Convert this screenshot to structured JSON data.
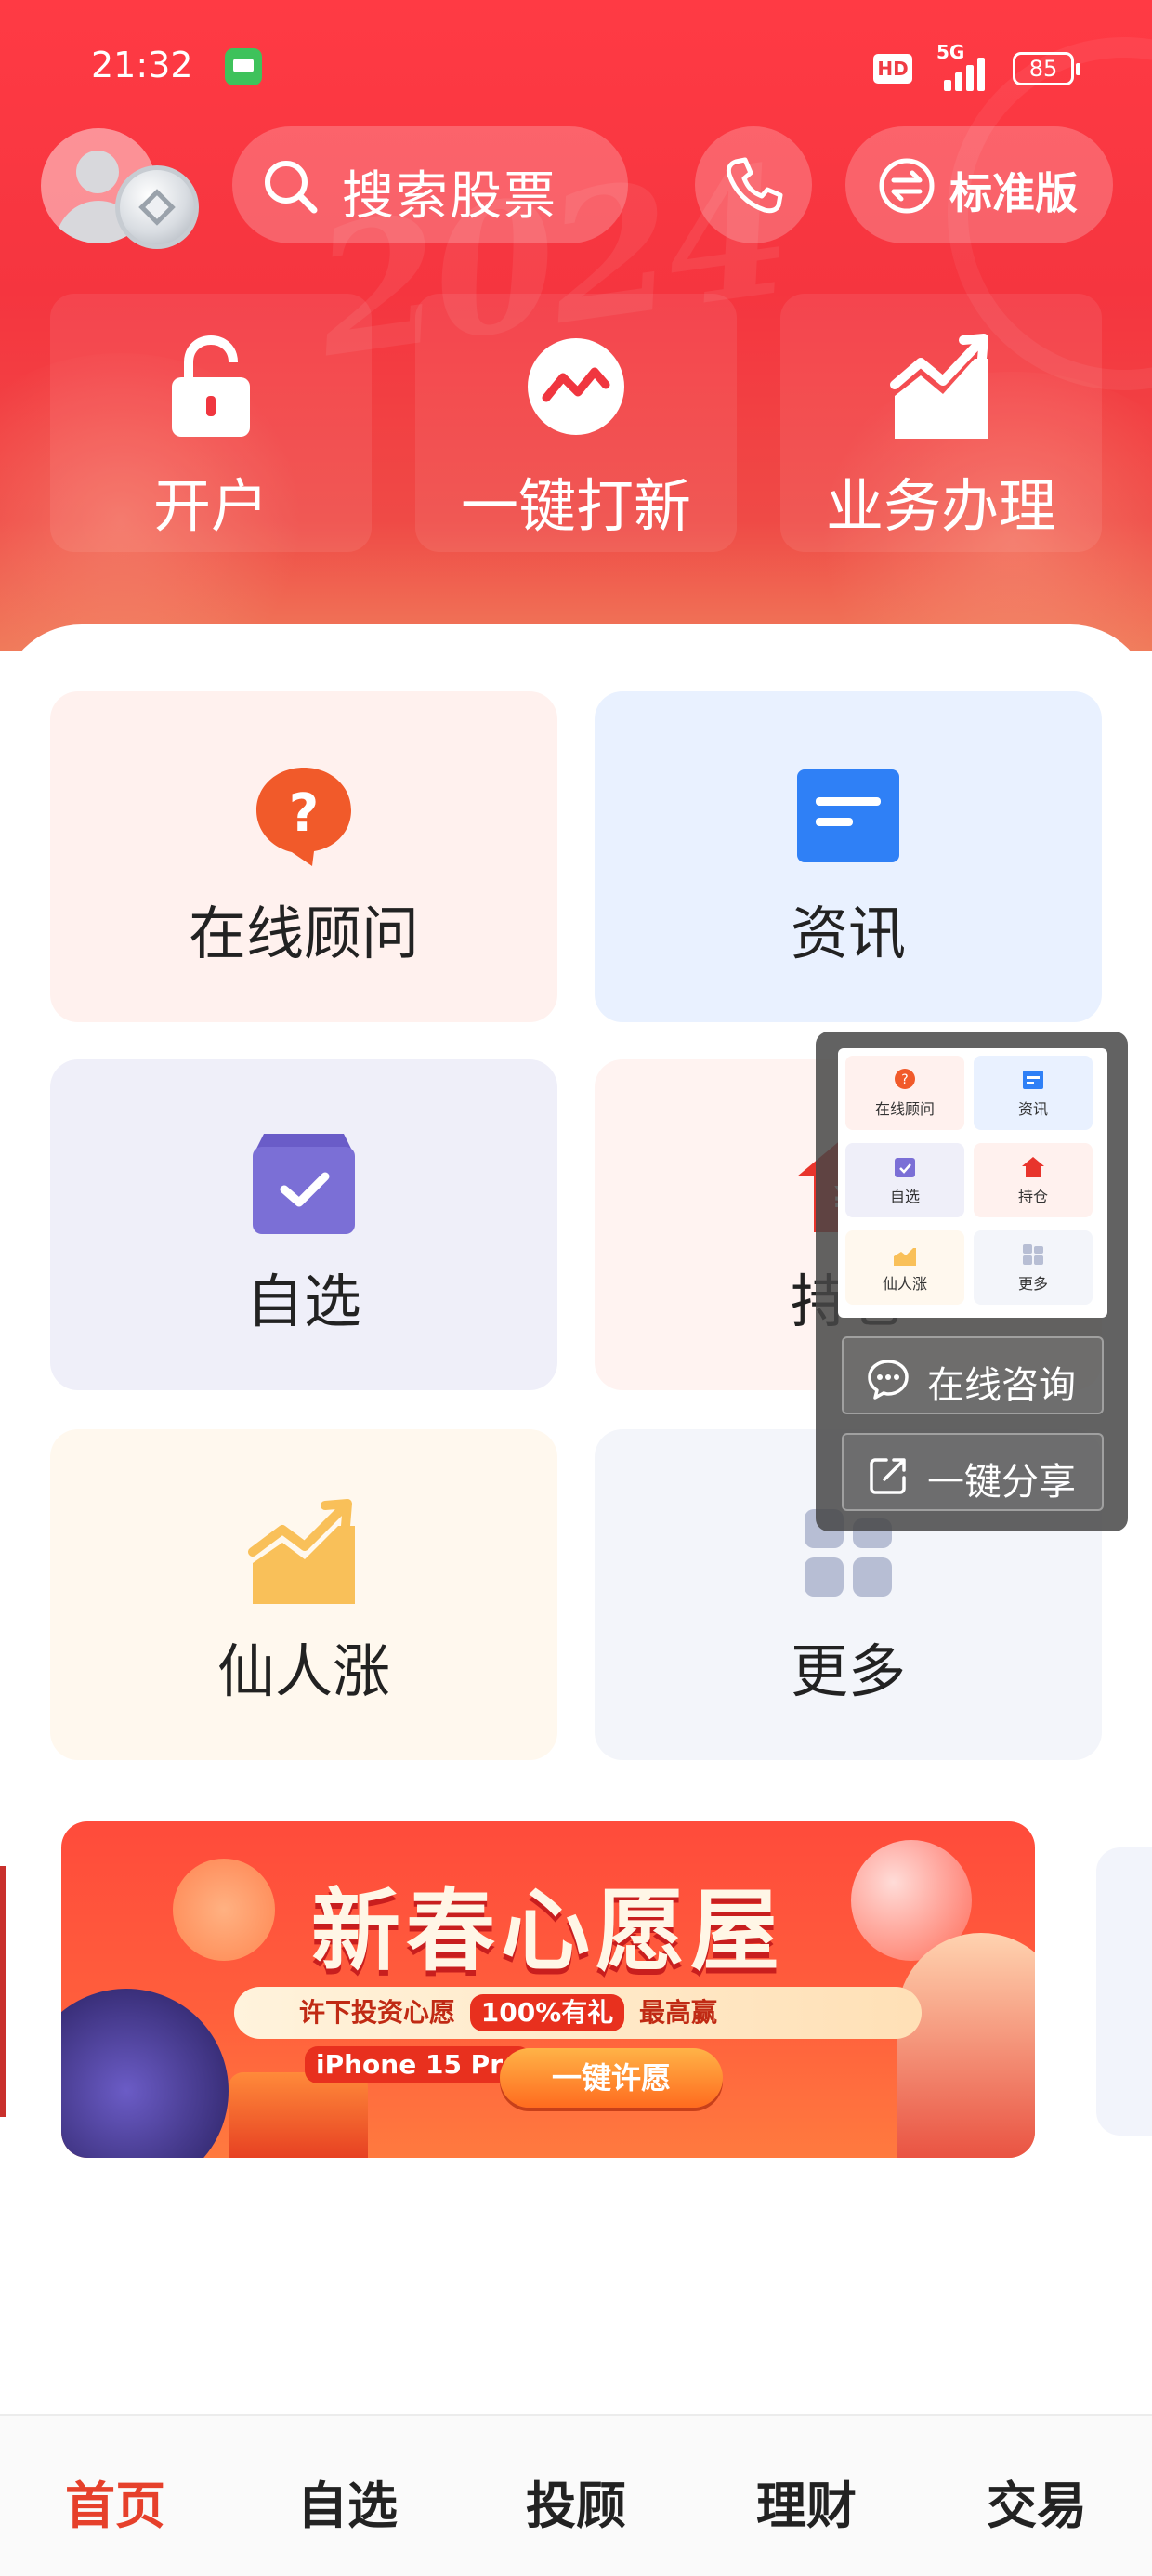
{
  "status_bar": {
    "time": "21:32",
    "network": "5G",
    "battery": "85",
    "hd": "HD"
  },
  "header": {
    "search_placeholder": "搜索股票",
    "version_label": "标准版",
    "decor_text": "2024",
    "quick_actions": [
      {
        "label": "开户",
        "icon": "lock-open-icon"
      },
      {
        "label": "一键打新",
        "icon": "trend-circle-icon"
      },
      {
        "label": "业务办理",
        "icon": "growth-chart-icon"
      }
    ]
  },
  "grid": [
    {
      "label": "在线顾问",
      "icon": "question-bubble-icon",
      "bg": "#fff1ee",
      "accent": "#f15a2a"
    },
    {
      "label": "资讯",
      "icon": "news-icon",
      "bg": "#e9f1ff",
      "accent": "#2f80f6"
    },
    {
      "label": "自选",
      "icon": "checkbox-tray-icon",
      "bg": "#efeff9",
      "accent": "#7b6fd6"
    },
    {
      "label": "持仓",
      "icon": "holdings-house-icon",
      "bg": "#fff3f1",
      "accent": "#e8342c"
    },
    {
      "label": "仙人涨",
      "icon": "rising-chart-icon",
      "bg": "#fff8ee",
      "accent": "#f9c059"
    },
    {
      "label": "更多",
      "icon": "more-grid-icon",
      "bg": "#f3f5fa",
      "accent": "#b7bed4"
    }
  ],
  "banner": {
    "title": "新春心愿屋",
    "subtitle_prefix": "许下投资心愿",
    "pill1": "100%有礼",
    "middle": "最高赢",
    "pill2": "iPhone 15 Pro",
    "button": "一键许愿"
  },
  "overlay": {
    "mini_items": [
      "在线顾问",
      "资讯",
      "自选",
      "持仓",
      "仙人涨",
      "更多"
    ],
    "buttons": [
      {
        "label": "在线咨询",
        "icon": "chat-bubble-icon"
      },
      {
        "label": "一键分享",
        "icon": "share-icon"
      }
    ]
  },
  "nav": [
    {
      "label": "首页",
      "active": true
    },
    {
      "label": "自选",
      "active": false
    },
    {
      "label": "投顾",
      "active": false
    },
    {
      "label": "理财",
      "active": false
    },
    {
      "label": "交易",
      "active": false
    }
  ],
  "colors": {
    "brand_red": "#f0363f",
    "nav_active": "#e6402b"
  }
}
